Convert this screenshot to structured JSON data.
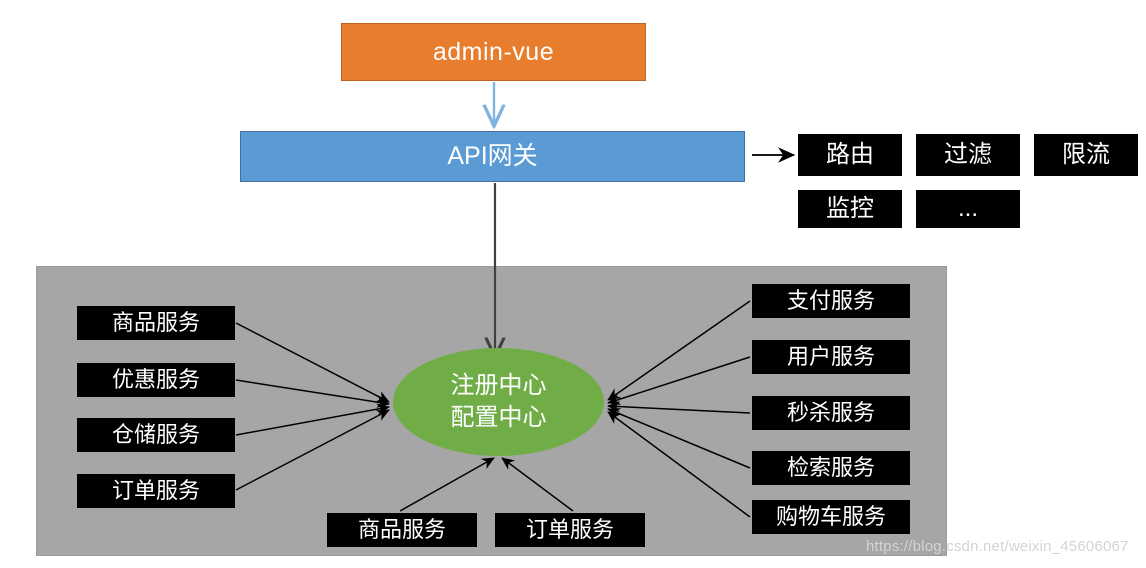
{
  "diagram": {
    "title": "admin-vue",
    "frontend": {
      "label": "admin-vue",
      "color": "#E87D2E"
    },
    "gateway": {
      "label": "API网关",
      "color": "#5B9BD5"
    },
    "gateway_features": [
      {
        "label": "路由"
      },
      {
        "label": "过滤"
      },
      {
        "label": "限流"
      },
      {
        "label": "监控"
      },
      {
        "label": "..."
      }
    ],
    "registry": {
      "line1": "注册中心",
      "line2": "配置中心",
      "color": "#70AD47"
    },
    "panel": {
      "color": "#A6A6A6"
    },
    "services_left": [
      {
        "label": "商品服务"
      },
      {
        "label": "优惠服务"
      },
      {
        "label": "仓储服务"
      },
      {
        "label": "订单服务"
      }
    ],
    "services_right": [
      {
        "label": "支付服务"
      },
      {
        "label": "用户服务"
      },
      {
        "label": "秒杀服务"
      },
      {
        "label": "检索服务"
      },
      {
        "label": "购物车服务"
      }
    ],
    "services_bottom": [
      {
        "label": "商品服务"
      },
      {
        "label": "订单服务"
      }
    ],
    "watermark": "https://blog.csdn.net/weixin_45606067"
  }
}
